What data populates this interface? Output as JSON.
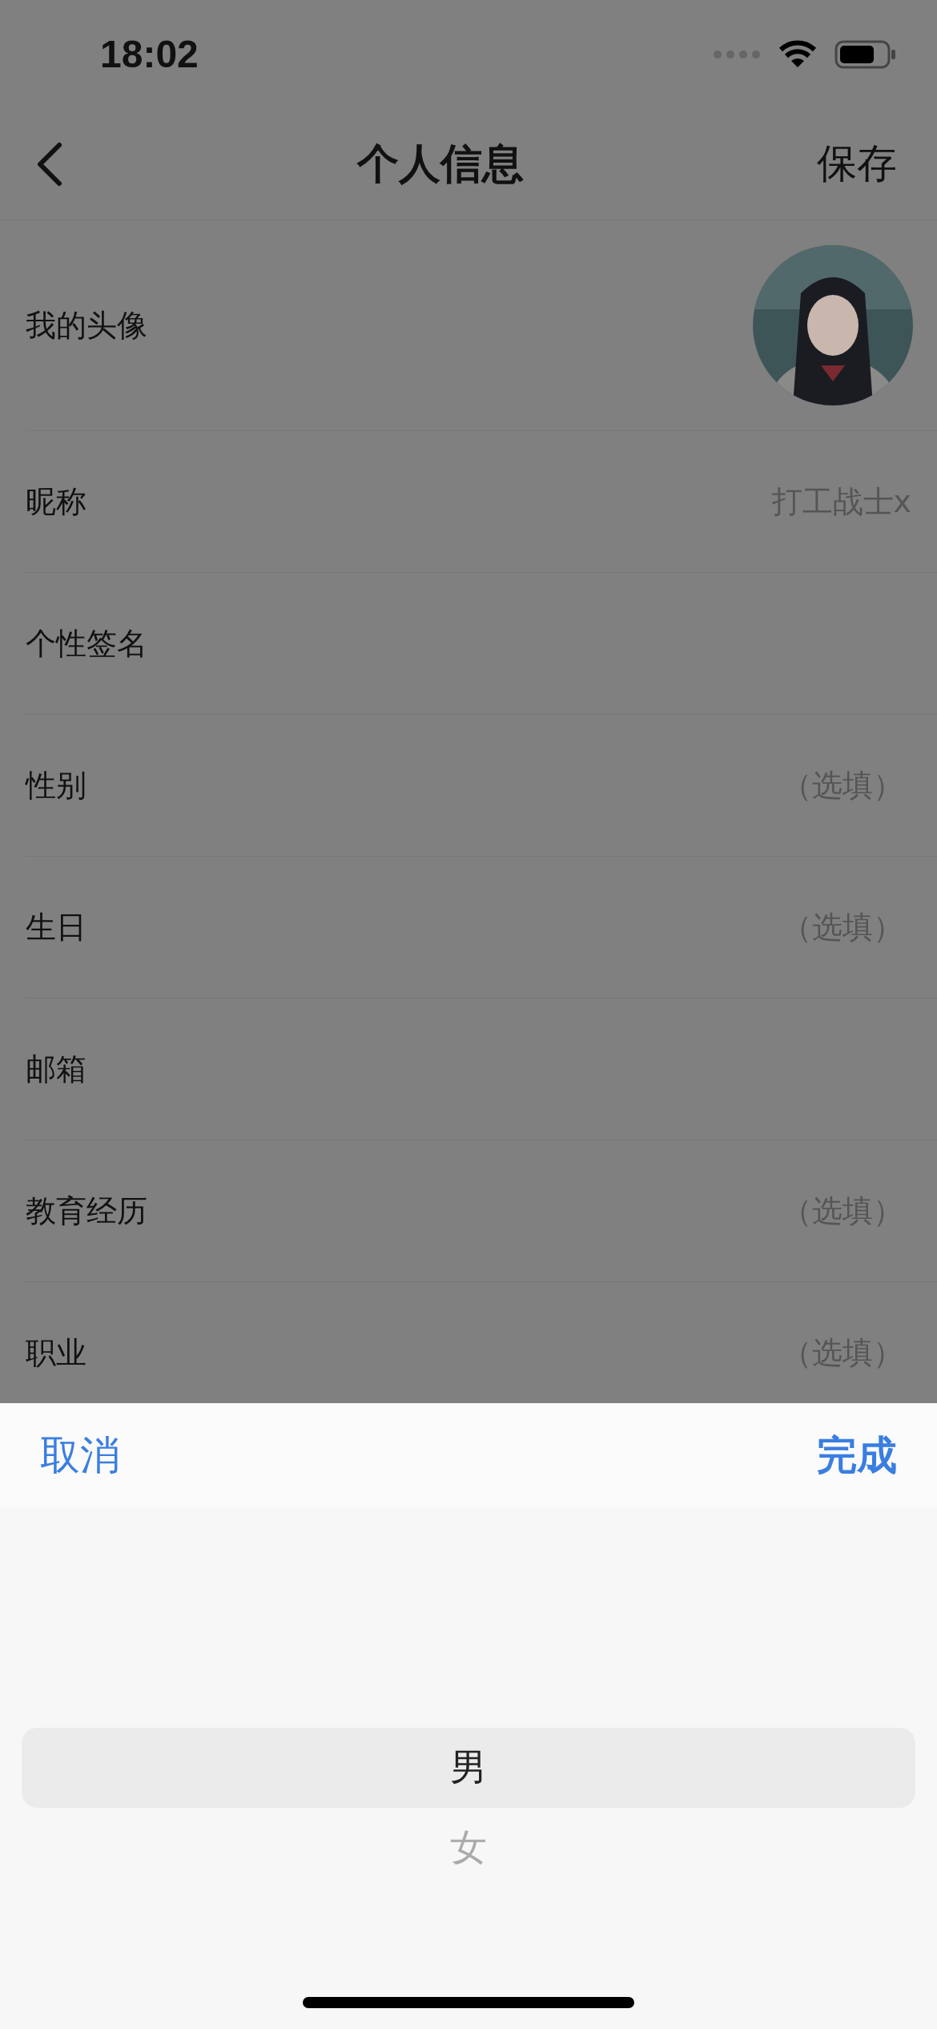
{
  "status_bar": {
    "time": "18:02"
  },
  "nav": {
    "title": "个人信息",
    "action": "保存"
  },
  "rows": [
    {
      "kind": "avatar",
      "label": "我的头像"
    },
    {
      "kind": "text",
      "label": "昵称",
      "value": "打工战士x"
    },
    {
      "kind": "text",
      "label": "个性签名"
    },
    {
      "kind": "text",
      "label": "性别",
      "placeholder": "（选填）"
    },
    {
      "kind": "text",
      "label": "生日",
      "placeholder": "（选填）"
    },
    {
      "kind": "text",
      "label": "邮箱"
    },
    {
      "kind": "text",
      "label": "教育经历",
      "placeholder": "（选填）"
    },
    {
      "kind": "text",
      "label": "职业",
      "placeholder": "（选填）"
    }
  ],
  "picker": {
    "cancel": "取消",
    "done": "完成",
    "options": [
      {
        "label": "男",
        "selected": true
      },
      {
        "label": "女",
        "selected": false
      }
    ]
  }
}
